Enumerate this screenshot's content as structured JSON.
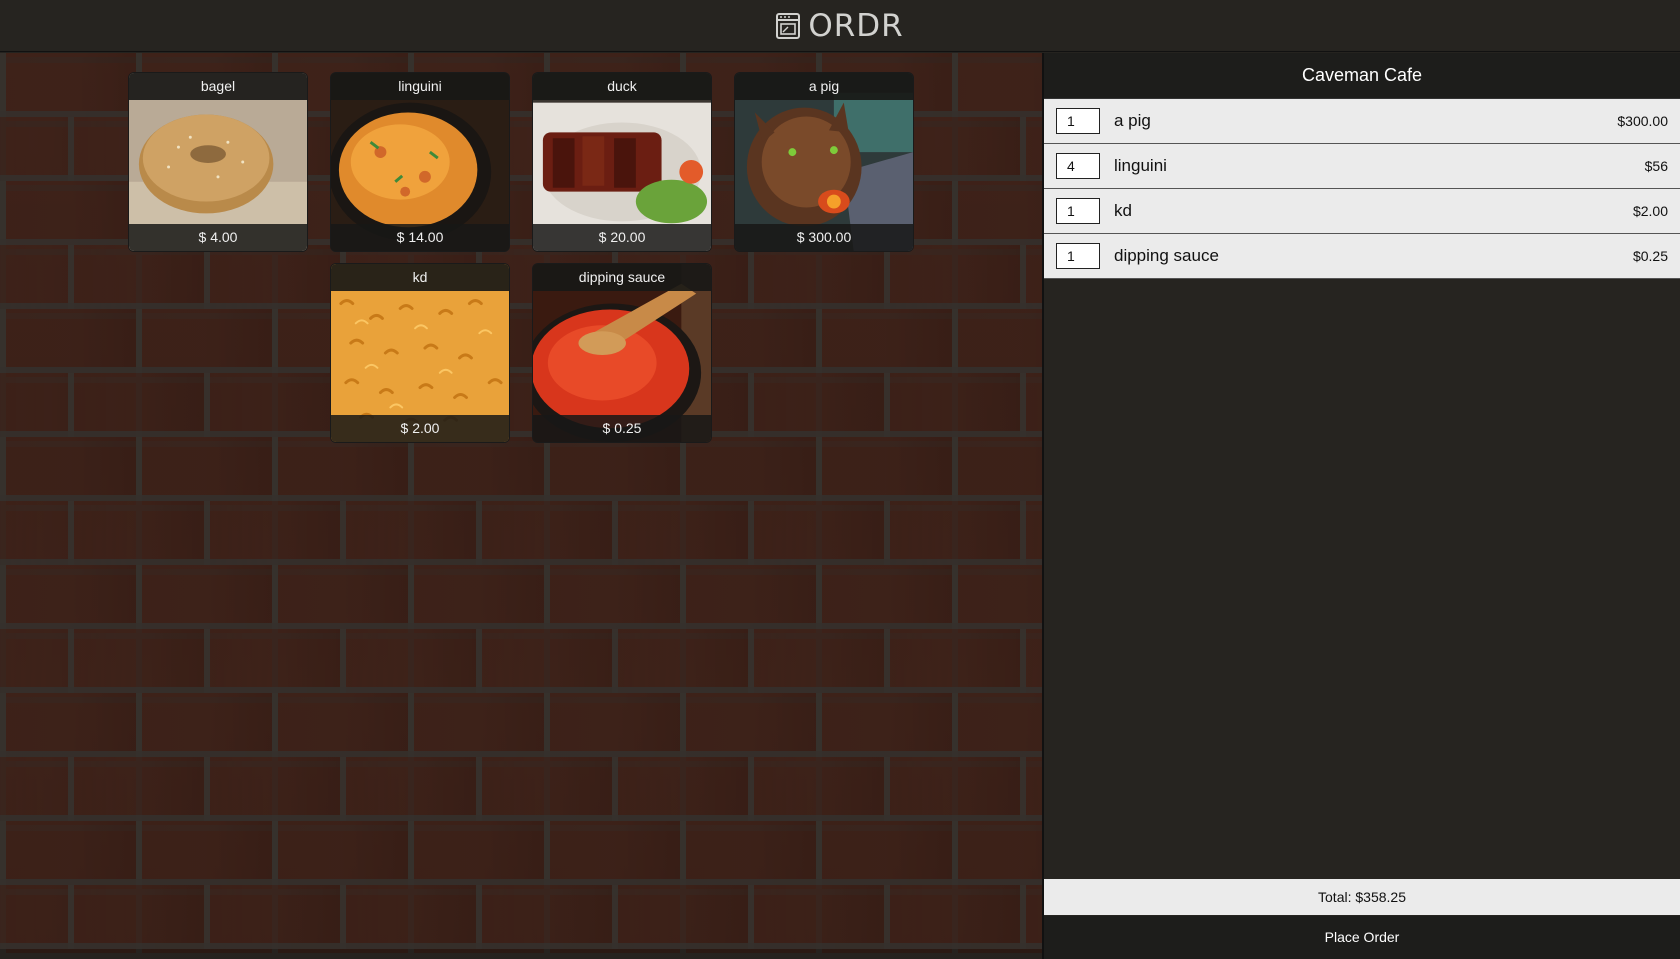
{
  "header": {
    "logo_text": "ORDR",
    "logo_icon": "oven-icon"
  },
  "menu": {
    "items": [
      {
        "name": "bagel",
        "price": "$ 4.00",
        "photo": "bagel-photo"
      },
      {
        "name": "linguini",
        "price": "$ 14.00",
        "photo": "linguini-photo"
      },
      {
        "name": "duck",
        "price": "$ 20.00",
        "photo": "duck-photo"
      },
      {
        "name": "a pig",
        "price": "$ 300.00",
        "photo": "pig-photo"
      },
      {
        "name": "kd",
        "price": "$ 2.00",
        "photo": "kd-photo"
      },
      {
        "name": "dipping sauce",
        "price": "$ 0.25",
        "photo": "sauce-photo"
      }
    ]
  },
  "order": {
    "restaurant": "Caveman Cafe",
    "rows": [
      {
        "qty": "1",
        "name": "a pig",
        "price": "$300.00"
      },
      {
        "qty": "4",
        "name": "linguini",
        "price": "$56"
      },
      {
        "qty": "1",
        "name": "kd",
        "price": "$2.00"
      },
      {
        "qty": "1",
        "name": "dipping sauce",
        "price": "$0.25"
      }
    ],
    "total": "Total: $358.25",
    "place_order_label": "Place Order"
  },
  "colors": {
    "header_bg": "#262420",
    "panel_bg": "#262420",
    "row_bg": "#ebebeb",
    "brick": "#5b2c20"
  }
}
